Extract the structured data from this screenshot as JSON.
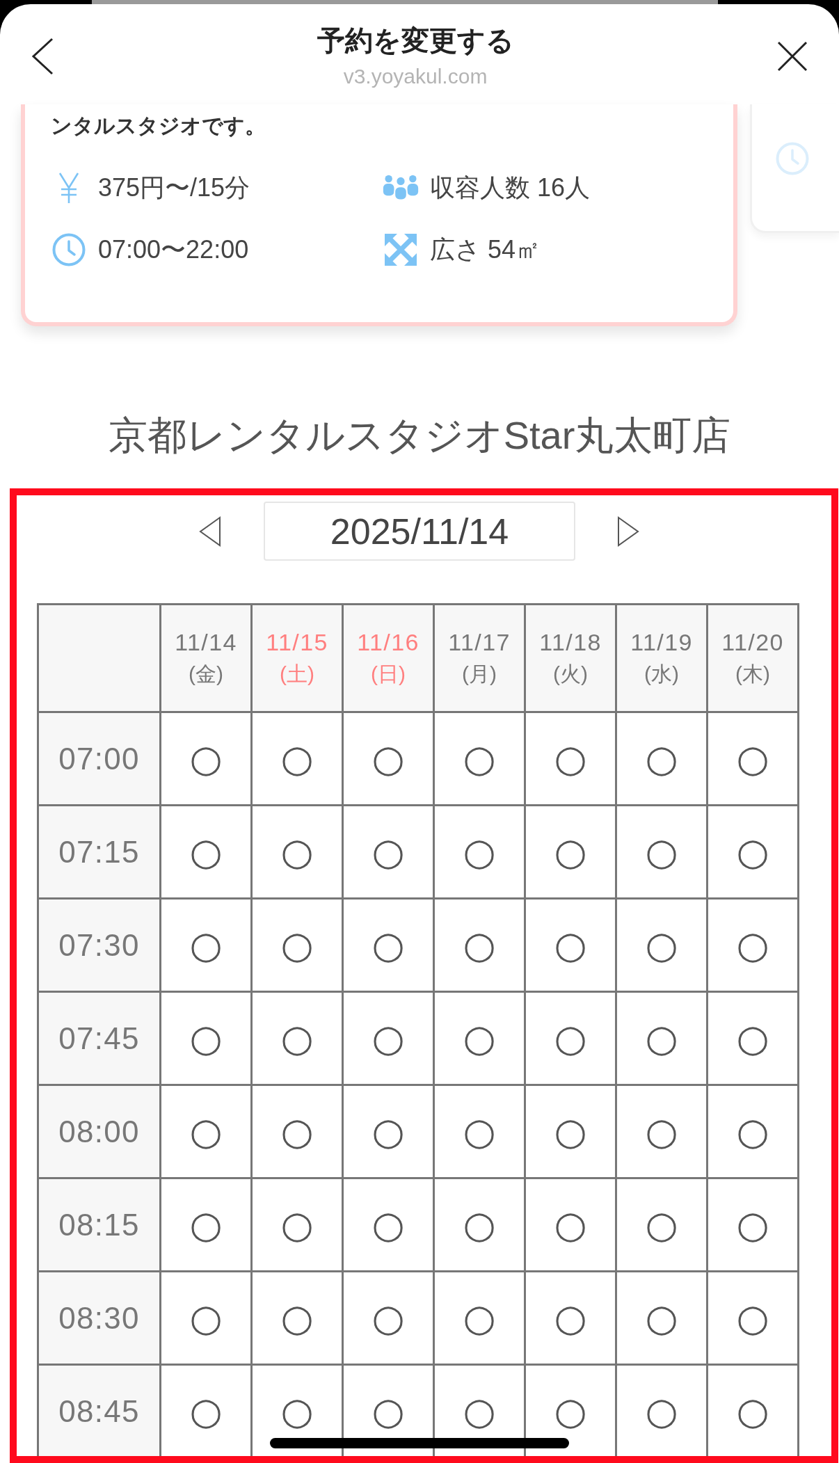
{
  "header": {
    "title": "予約を変更する",
    "url": "v3.yoyakul.com"
  },
  "studio_card": {
    "description": "ンタルスタジオです。",
    "details": [
      {
        "kind": "price",
        "text": "375円〜/15分"
      },
      {
        "kind": "capacity",
        "text": "収容人数 16人"
      },
      {
        "kind": "hours",
        "text": "07:00〜22:00"
      },
      {
        "kind": "area",
        "text": "広さ 54㎡"
      }
    ]
  },
  "shop_name": "京都レンタルスタジオStar丸太町店",
  "date_picker": {
    "date": "2025/11/14"
  },
  "schedule": {
    "days": [
      {
        "date": "11/14",
        "weekday": "(金)",
        "weekend": false
      },
      {
        "date": "11/15",
        "weekday": "(土)",
        "weekend": true
      },
      {
        "date": "11/16",
        "weekday": "(日)",
        "weekend": true
      },
      {
        "date": "11/17",
        "weekday": "(月)",
        "weekend": false
      },
      {
        "date": "11/18",
        "weekday": "(火)",
        "weekend": false
      },
      {
        "date": "11/19",
        "weekday": "(水)",
        "weekend": false
      },
      {
        "date": "11/20",
        "weekday": "(木)",
        "weekend": false
      }
    ],
    "slots": [
      {
        "time": "07:00",
        "cells": [
          "○",
          "○",
          "○",
          "○",
          "○",
          "○",
          "○"
        ]
      },
      {
        "time": "07:15",
        "cells": [
          "○",
          "○",
          "○",
          "○",
          "○",
          "○",
          "○"
        ]
      },
      {
        "time": "07:30",
        "cells": [
          "○",
          "○",
          "○",
          "○",
          "○",
          "○",
          "○"
        ]
      },
      {
        "time": "07:45",
        "cells": [
          "○",
          "○",
          "○",
          "○",
          "○",
          "○",
          "○"
        ]
      },
      {
        "time": "08:00",
        "cells": [
          "○",
          "○",
          "○",
          "○",
          "○",
          "○",
          "○"
        ]
      },
      {
        "time": "08:15",
        "cells": [
          "○",
          "○",
          "○",
          "○",
          "○",
          "○",
          "○"
        ]
      },
      {
        "time": "08:30",
        "cells": [
          "○",
          "○",
          "○",
          "○",
          "○",
          "○",
          "○"
        ]
      },
      {
        "time": "08:45",
        "cells": [
          "○",
          "○",
          "○",
          "○",
          "○",
          "○",
          "○"
        ]
      }
    ]
  }
}
